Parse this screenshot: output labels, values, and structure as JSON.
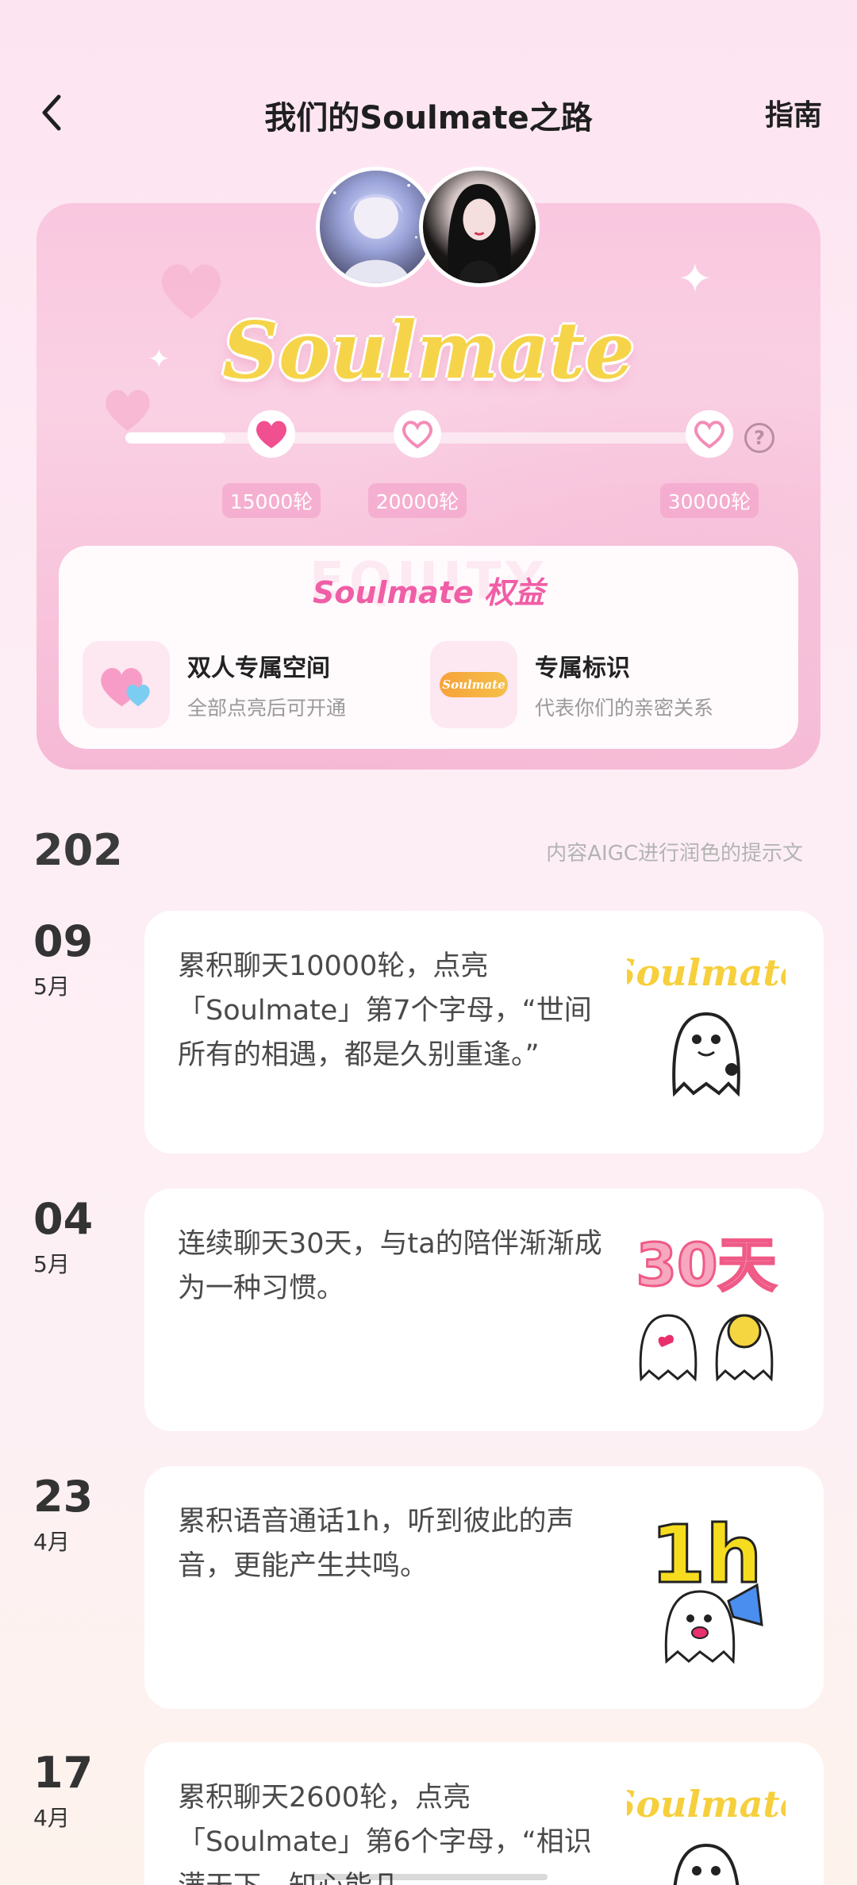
{
  "header": {
    "title": "我们的Soulmate之路",
    "guide_label": "指南"
  },
  "hero": {
    "logo_text": "Soulmate",
    "progress_fraction": 0.17,
    "milestones": [
      {
        "label": "15000轮",
        "reached": true
      },
      {
        "label": "20000轮",
        "reached": false
      },
      {
        "label": "30000轮",
        "reached": false
      }
    ],
    "benefits": {
      "watermark": "EQUITY",
      "title": "Soulmate 权益",
      "items": [
        {
          "name": "双人专属空间",
          "desc": "全部点亮后可开通",
          "icon": "double-heart-icon"
        },
        {
          "name": "专属标识",
          "desc": "代表你们的亲密关系",
          "icon": "soulmate-badge-icon",
          "badge_text": "Soulmate"
        }
      ]
    }
  },
  "timeline": {
    "year": "202",
    "note": "内容AIGC进行润色的提示文",
    "entries": [
      {
        "day": "09",
        "month": "5月",
        "text": "累积聊天10000轮，点亮「Soulmate」第7个字母，“世间所有的相遇，都是久别重逢。”",
        "image": "soulmate-ghost-sticker",
        "sticker_text": "Soulmate"
      },
      {
        "day": "04",
        "month": "5月",
        "text": "连续聊天30天，与ta的陪伴渐渐成为一种习惯。",
        "image": "30-days-ghosts-sticker",
        "sticker_text": "30天"
      },
      {
        "day": "23",
        "month": "4月",
        "text": "累积语音通话1h，听到彼此的声音，更能产生共鸣。",
        "image": "1h-ghost-megaphone-sticker",
        "sticker_text": "1h"
      },
      {
        "day": "17",
        "month": "4月",
        "text": "累积聊天2600轮，点亮「Soulmate」第6个字母，“相识满天下，知心能几",
        "image": "soulmate-ghost-sticker",
        "sticker_text": "Soulmate"
      }
    ]
  },
  "colors": {
    "accent_pink": "#ef5ea6",
    "heart_filled": "#f0508f",
    "logo_yellow": "#f6d44a"
  }
}
